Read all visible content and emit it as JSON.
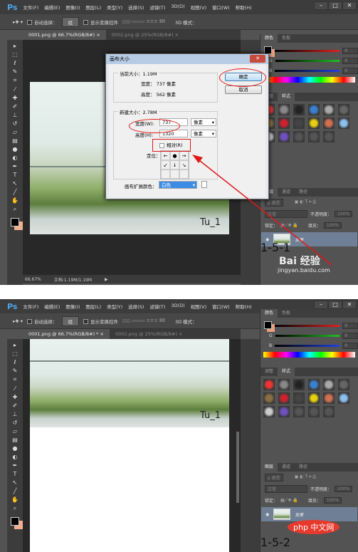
{
  "app": {
    "logo": "Ps",
    "menu": [
      "文件(F)",
      "编辑(E)",
      "图像(I)",
      "图层(L)",
      "类型(Y)",
      "选择(S)",
      "滤镜(T)",
      "3D(D)",
      "视图(V)",
      "窗口(W)",
      "帮助(H)"
    ],
    "win_buttons": [
      "–",
      "□",
      "✕"
    ]
  },
  "options": {
    "auto_select": "自动选择：",
    "group": "组",
    "show_transform": "显示变换控件",
    "mode3d": "3D 模式："
  },
  "top": {
    "tabs": [
      "0001.png @ 66.7%(RGB/8#)",
      "0002.png @ 25%(RGB/8#)"
    ],
    "image_label": "Tu_1",
    "status_zoom": "66.67%",
    "status_doc": "文档:1.19M/1.19M",
    "caption": "1-5-1",
    "watermark": {
      "brand": "Bai 经验",
      "url": "jingyan.baidu.com"
    }
  },
  "bottom": {
    "tabs": [
      "0001.png @ 66.7%(RGB/8#) *",
      "0002.png @ 25%(RGB/8#)"
    ],
    "image_label": "Tu_1",
    "caption": "1-5-2",
    "watermark": {
      "brand": "php 中文网"
    }
  },
  "panels": {
    "color_tabs": [
      "颜色",
      "色板"
    ],
    "channels": [
      {
        "label": "R",
        "value": "0",
        "color": "#e02020"
      },
      {
        "label": "G",
        "value": "0",
        "color": "#20c020"
      },
      {
        "label": "B",
        "value": "0",
        "color": "#2040e0"
      }
    ],
    "style_tabs": [
      "调整",
      "样式"
    ],
    "layer_tabs": [
      "图层",
      "通道",
      "路径"
    ],
    "kind": "ρ 类型",
    "blend": "正常",
    "opacity_label": "不透明度：",
    "opacity": "100%",
    "lock_label": "锁定：",
    "fill_label": "填充：",
    "fill": "100%",
    "layer_name": "背景"
  },
  "dialog": {
    "title": "画布大小",
    "close": "✕",
    "current_label": "当前大小：1.19M",
    "cur_width": "宽度：  737 像素",
    "cur_height": "高度：  562 像素",
    "new_label": "新建大小：2.78M",
    "width_label": "宽度(W):",
    "width_value": "737",
    "height_label": "高度(H):",
    "height_value": "1320",
    "unit": "像素",
    "relative": "相对(R)",
    "anchor_label": "定位：",
    "anchor": [
      "←",
      "●",
      "→",
      "↙",
      "↓",
      "↘",
      "",
      "",
      ""
    ],
    "ext_color_label": "画布扩展颜色：",
    "ext_color": "白色",
    "ok": "确定",
    "cancel": "取消"
  },
  "colors": {
    "annotation_red": "#e01818",
    "canvas_bg": "#282828",
    "ui_bg": "#535353"
  }
}
